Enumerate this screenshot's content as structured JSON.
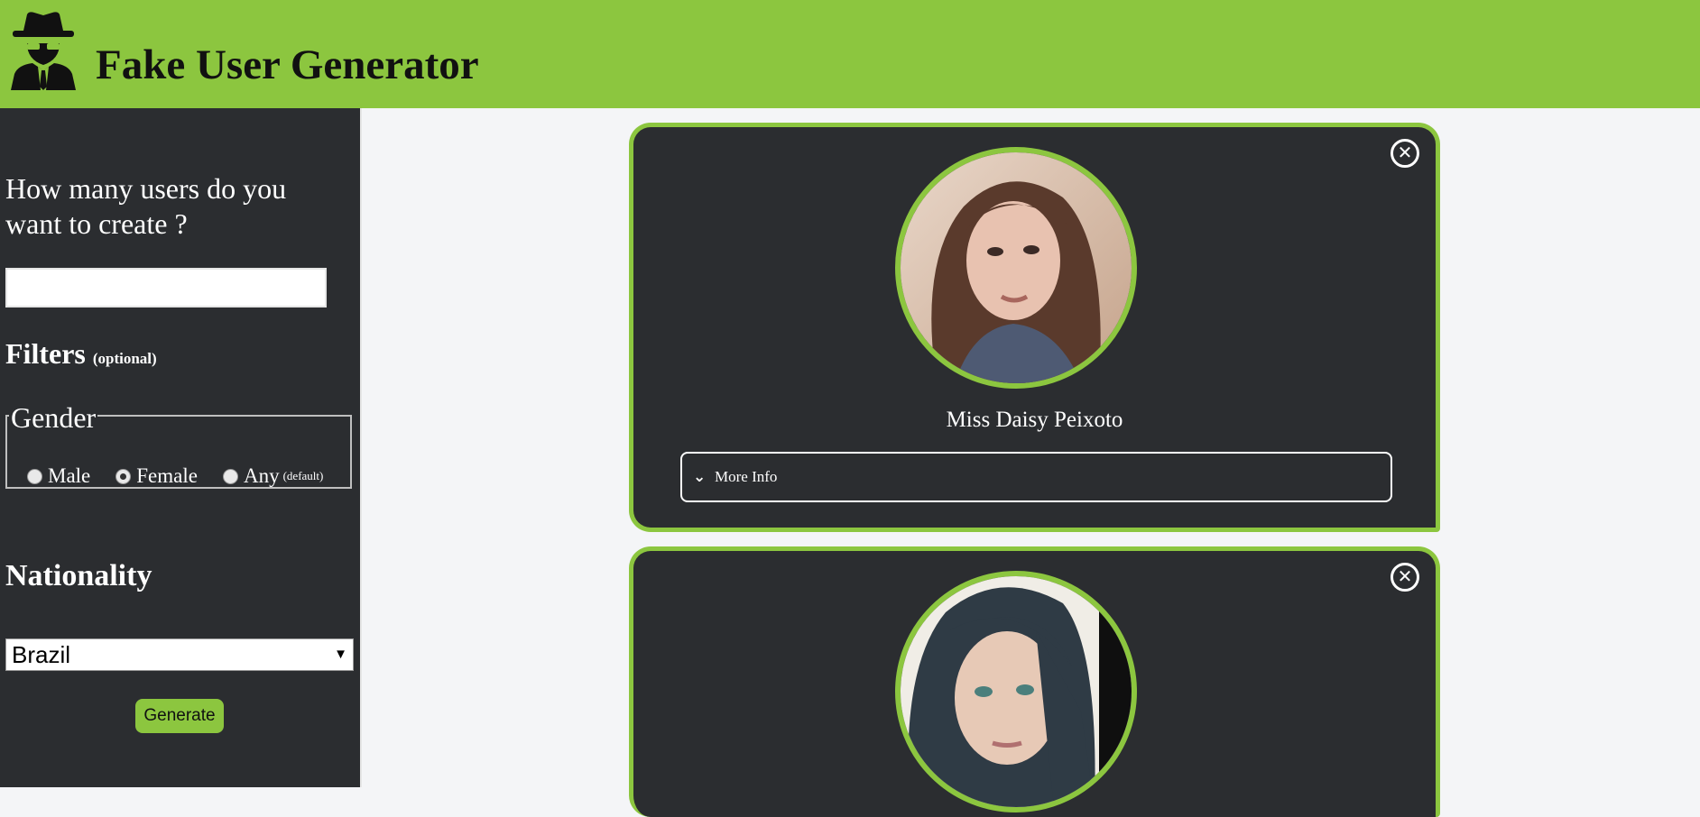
{
  "header": {
    "title": "Fake User Generator",
    "logo_icon": "spy-icon",
    "bg_color": "#8cc63f"
  },
  "sidebar": {
    "question": "How many users do you want to create ?",
    "count_input_value": "",
    "filters_heading": "Filters",
    "filters_note": "(optional)",
    "gender_legend": "Gender",
    "gender_options": [
      {
        "label": "Male",
        "checked": false
      },
      {
        "label": "Female",
        "checked": true
      },
      {
        "label": "Any",
        "note": "(default)",
        "checked": false
      }
    ],
    "nationality_heading": "Nationality",
    "nationality_selected": "Brazil",
    "generate_label": "Generate"
  },
  "cards": [
    {
      "name": "Miss Daisy Peixoto",
      "more_info_label": "More Info"
    },
    {
      "name": "",
      "more_info_label": ""
    }
  ]
}
